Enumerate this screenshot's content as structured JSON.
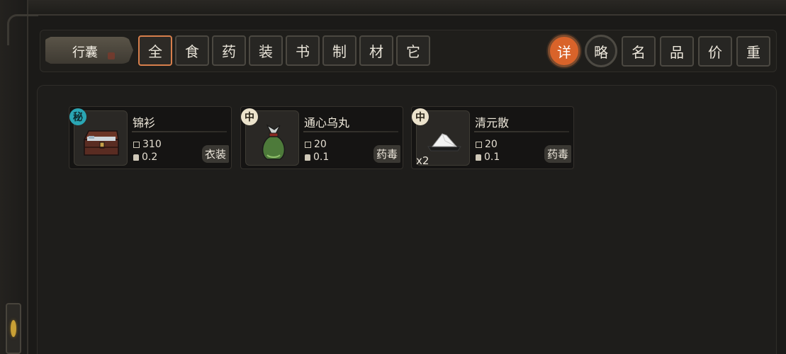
{
  "inventory": {
    "title": "行囊",
    "filter_tabs": [
      "全",
      "食",
      "药",
      "装",
      "书",
      "制",
      "材",
      "它"
    ],
    "active_filter": "全",
    "view_modes": [
      "详",
      "略"
    ],
    "active_view": "详",
    "sort_buttons": [
      "名",
      "品",
      "价",
      "重"
    ]
  },
  "items": [
    {
      "name": "锦衫",
      "grade": "秘",
      "price": "310",
      "weight": "0.2",
      "category": "衣装",
      "icon": "chest-icon"
    },
    {
      "name": "通心乌丸",
      "grade": "中",
      "price": "20",
      "weight": "0.1",
      "category": "药毒",
      "icon": "pill-bag-icon"
    },
    {
      "name": "清元散",
      "grade": "中",
      "price": "20",
      "weight": "0.1",
      "category": "药毒",
      "quantity": "x2",
      "icon": "powder-icon"
    }
  ],
  "colors": {
    "accent": "#d9632a",
    "secret_badge": "#2aa6b4",
    "mid_badge": "#ece3cc"
  }
}
